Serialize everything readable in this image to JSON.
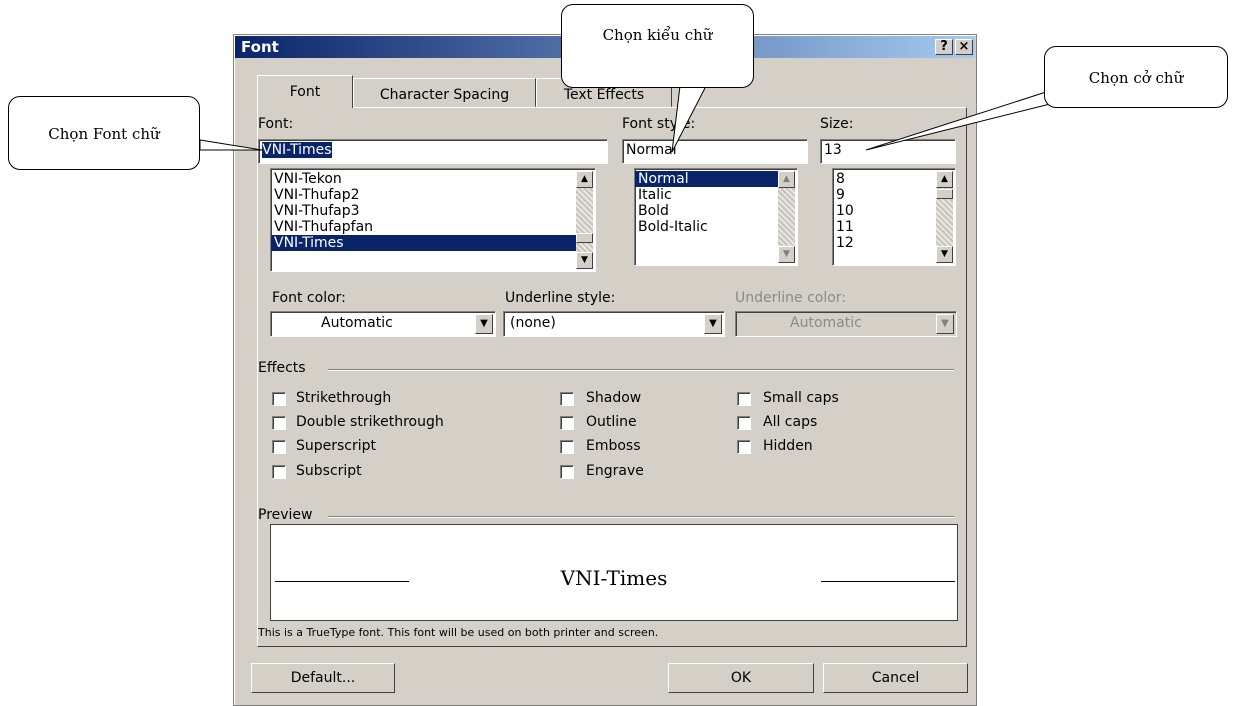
{
  "dialog": {
    "title": "Font",
    "help_label": "?",
    "close_label": "×"
  },
  "tabs": [
    {
      "label": "Font"
    },
    {
      "label": "Character Spacing"
    },
    {
      "label": "Text Effects"
    }
  ],
  "font": {
    "label": "Font:",
    "value": "VNI-Times",
    "items": [
      "VNI-Tekon",
      "VNI-Thufap2",
      "VNI-Thufap3",
      "VNI-Thufapfan",
      "VNI-Times"
    ],
    "selected": "VNI-Times"
  },
  "style": {
    "label": "Font style:",
    "value": "Normal",
    "items": [
      "Normal",
      "Italic",
      "Bold",
      "Bold-Italic"
    ],
    "selected": "Normal"
  },
  "size": {
    "label": "Size:",
    "value": "13",
    "items": [
      "8",
      "9",
      "10",
      "11",
      "12"
    ]
  },
  "font_color": {
    "label": "Font color:",
    "value": "Automatic"
  },
  "underline_style": {
    "label": "Underline style:",
    "value": "(none)"
  },
  "underline_color": {
    "label": "Underline color:",
    "value": "Automatic"
  },
  "effects": {
    "label": "Effects",
    "col1": [
      "Strikethrough",
      "Double strikethrough",
      "Superscript",
      "Subscript"
    ],
    "col2": [
      "Shadow",
      "Outline",
      "Emboss",
      "Engrave"
    ],
    "col3": [
      "Small caps",
      "All caps",
      "Hidden"
    ]
  },
  "preview": {
    "label": "Preview",
    "text": "VNI-Times",
    "note": "This is a TrueType font. This font will be used on both printer and screen."
  },
  "buttons": {
    "default": "Default...",
    "ok": "OK",
    "cancel": "Cancel"
  },
  "callouts": {
    "font": "Chọn Font chữ",
    "style": "Chọn kiểu chữ",
    "size": "Chọn cở chữ"
  }
}
